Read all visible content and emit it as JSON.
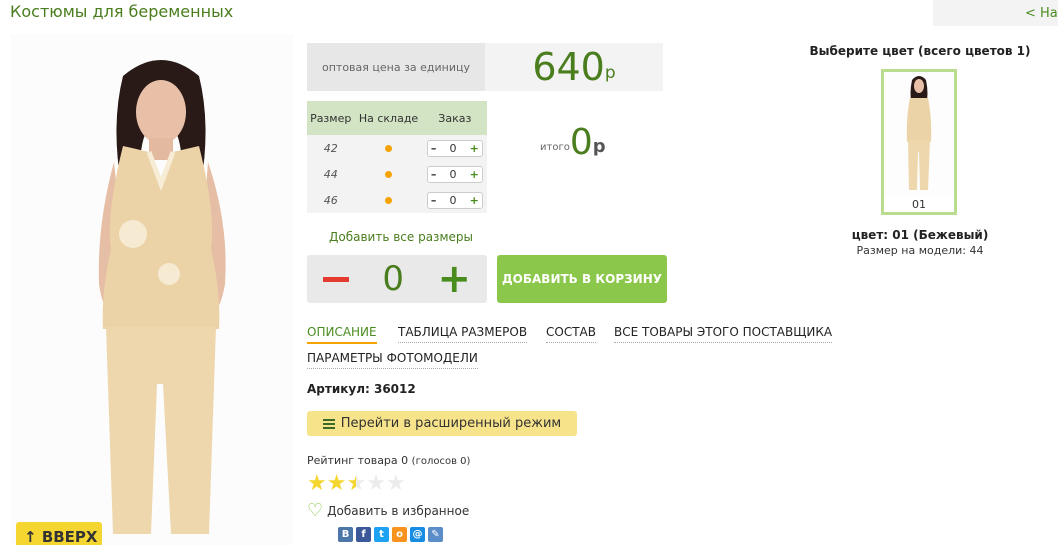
{
  "header": {
    "title": "Костюмы для беременных",
    "back_label": "< На"
  },
  "photo": {
    "alt": "product-photo"
  },
  "up_button": {
    "label": "ВВЕРХ",
    "arrow": "↑"
  },
  "price": {
    "label": "оптовая цена за единицу",
    "value": "640",
    "currency": "р"
  },
  "sizes_table": {
    "headers": [
      "Размер",
      "На складе",
      "Заказ"
    ],
    "rows": [
      {
        "size": "42",
        "qty": "0"
      },
      {
        "size": "44",
        "qty": "0"
      },
      {
        "size": "46",
        "qty": "0"
      }
    ],
    "minus": "–",
    "plus": "+"
  },
  "total": {
    "label": "итого",
    "value": "0",
    "currency": "р"
  },
  "add_all_label": "Добавить все размеры",
  "quantity": {
    "value": "0",
    "minus_icon": "minus-icon",
    "plus_label": "+"
  },
  "cart_button_label": "ДОБАВИТЬ В КОРЗИНУ",
  "tabs": [
    {
      "label": "ОПИСАНИЕ",
      "active": true
    },
    {
      "label": "ТАБЛИЦА РАЗМЕРОВ",
      "active": false
    },
    {
      "label": "СОСТАВ",
      "active": false
    },
    {
      "label": "ВСЕ ТОВАРЫ ЭТОГО ПОСТАВЩИКА",
      "active": false
    },
    {
      "label": "ПАРАМЕТРЫ ФОТОМОДЕЛИ",
      "active": false
    }
  ],
  "article": "Артикул: 36012",
  "extended_mode_label": "Перейти в расширенный режим",
  "rating": {
    "label": "Рейтинг товара",
    "value": "0",
    "votes": "(голосов 0)",
    "stars_filled": 2.5,
    "stars_total": 5
  },
  "favorite_label": "Добавить в избранное",
  "social": [
    {
      "icon": "vk-icon",
      "glyph": "B",
      "color": "#4a76a8"
    },
    {
      "icon": "facebook-icon",
      "glyph": "f",
      "color": "#3b5998"
    },
    {
      "icon": "twitter-icon",
      "glyph": "t",
      "color": "#1da1f2"
    },
    {
      "icon": "odnoklassniki-icon",
      "glyph": "о",
      "color": "#f7931e"
    },
    {
      "icon": "mailru-icon",
      "glyph": "@",
      "color": "#168de2"
    },
    {
      "icon": "livejournal-icon",
      "glyph": "✎",
      "color": "#5b8ec9"
    }
  ],
  "colors": {
    "heading": "Выберите цвет (всего цветов 1)",
    "swatch_code": "01",
    "selected_name": "цвет: 01 (Бежевый)",
    "model_size": "Размер на модели: 44"
  },
  "palette": {
    "green_text": "#4a7d1d",
    "green_button": "#8bc74a",
    "orange": "#f5a300",
    "yellow": "#f5d630",
    "beige": "#e8cfa3"
  }
}
